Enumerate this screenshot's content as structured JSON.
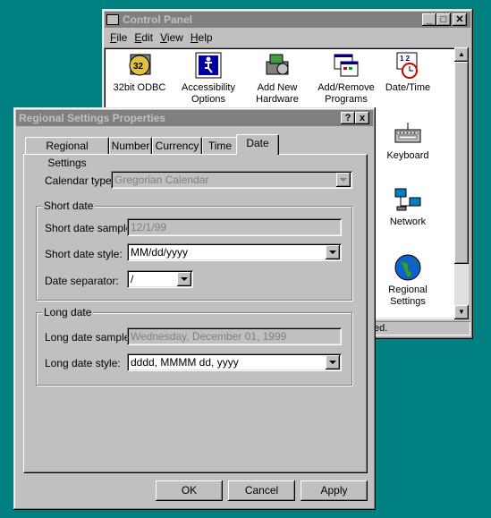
{
  "control_panel": {
    "title": "Control Panel",
    "menu": [
      "File",
      "Edit",
      "View",
      "Help"
    ],
    "icons": [
      {
        "label": "32bit ODBC",
        "icon": "odbc-icon"
      },
      {
        "label": "Accessibility Options",
        "icon": "accessibility-icon"
      },
      {
        "label": "Add New Hardware",
        "icon": "hardware-icon"
      },
      {
        "label": "Add/Remove Programs",
        "icon": "programs-icon"
      },
      {
        "label": "Date/Time",
        "icon": "datetime-icon"
      },
      {
        "label": "Keyboard",
        "icon": "keyboard-icon"
      },
      {
        "label": "Network",
        "icon": "network-icon"
      },
      {
        "label": "Regional Settings",
        "icon": "globe-icon"
      }
    ],
    "status_text": "ed."
  },
  "dialog": {
    "title": "Regional Settings Properties",
    "help_btn": "?",
    "close_btn": "x",
    "tabs": [
      "Regional Settings",
      "Number",
      "Currency",
      "Time",
      "Date"
    ],
    "active_tab": "Date",
    "calendar_type_label": "Calendar type:",
    "calendar_type_value": "Gregorian Calendar",
    "short_date": {
      "group_label": "Short date",
      "sample_label": "Short date sample:",
      "sample_value": "12/1/99",
      "style_label": "Short date style:",
      "style_value": "MM/dd/yyyy",
      "separator_label": "Date separator:",
      "separator_value": "/"
    },
    "long_date": {
      "group_label": "Long date",
      "sample_label": "Long date sample:",
      "sample_value": "Wednesday, December 01, 1999",
      "style_label": "Long date style:",
      "style_value": "dddd, MMMM dd, yyyy"
    },
    "buttons": {
      "ok": "OK",
      "cancel": "Cancel",
      "apply": "Apply"
    }
  },
  "colors": {
    "desktop": "#008080",
    "title_active": "#000080",
    "title_inactive": "#808080",
    "face": "#c0c0c0"
  }
}
